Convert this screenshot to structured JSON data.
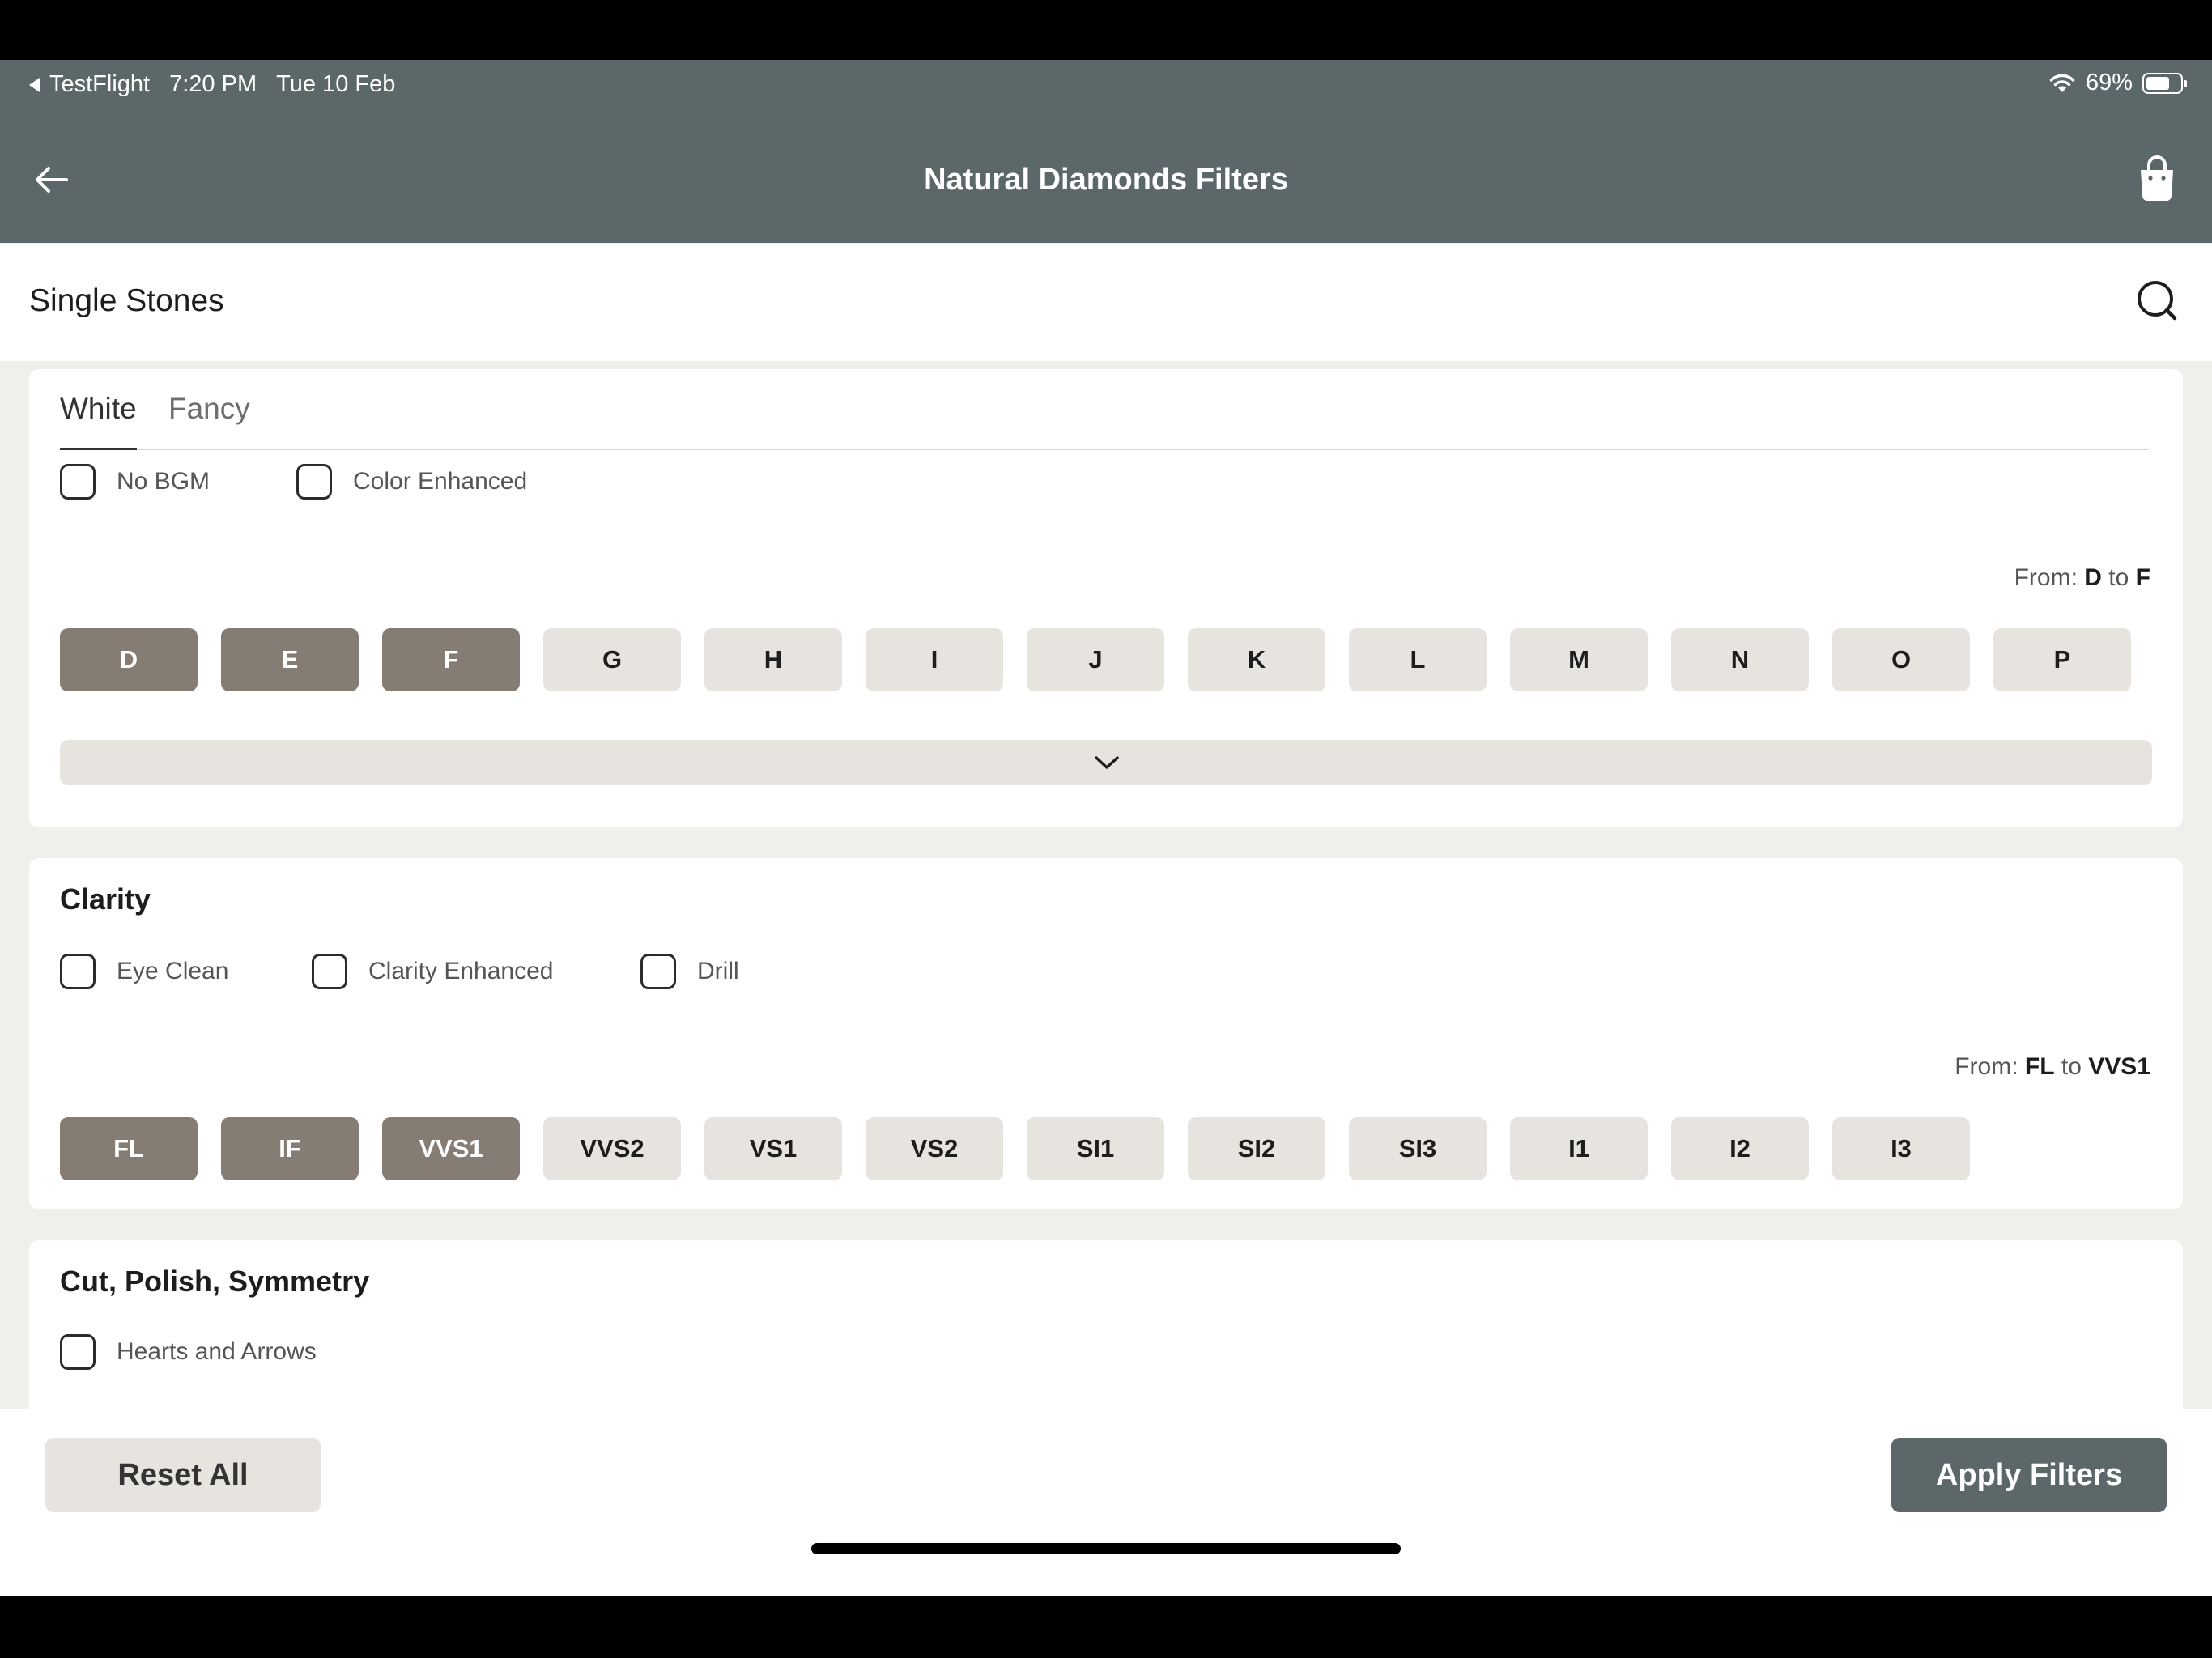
{
  "status_bar": {
    "back_app": "TestFlight",
    "time": "7:20 PM",
    "date": "Tue 10 Feb",
    "battery": "69%",
    "battery_level": 0.69
  },
  "header": {
    "title": "Natural Diamonds Filters",
    "back_icon": "arrow-left-icon",
    "cart_icon": "shopping-bag-icon"
  },
  "subheader": {
    "title": "Single Stones",
    "search_icon": "search-icon"
  },
  "color_section": {
    "tabs": [
      {
        "label": "White",
        "active": true
      },
      {
        "label": "Fancy",
        "active": false
      }
    ],
    "checkboxes": [
      {
        "label": "No BGM",
        "checked": false
      },
      {
        "label": "Color Enhanced",
        "checked": false
      }
    ],
    "range": {
      "prefix": "From:",
      "from": "D",
      "mid": "to",
      "to": "F"
    },
    "grades": [
      {
        "label": "D",
        "selected": true
      },
      {
        "label": "E",
        "selected": true
      },
      {
        "label": "F",
        "selected": true
      },
      {
        "label": "G",
        "selected": false
      },
      {
        "label": "H",
        "selected": false
      },
      {
        "label": "I",
        "selected": false
      },
      {
        "label": "J",
        "selected": false
      },
      {
        "label": "K",
        "selected": false
      },
      {
        "label": "L",
        "selected": false
      },
      {
        "label": "M",
        "selected": false
      },
      {
        "label": "N",
        "selected": false
      },
      {
        "label": "O",
        "selected": false
      },
      {
        "label": "P",
        "selected": false
      }
    ],
    "expand_icon": "chevron-down-icon"
  },
  "clarity_section": {
    "title": "Clarity",
    "checkboxes": [
      {
        "label": "Eye Clean",
        "checked": false
      },
      {
        "label": "Clarity Enhanced",
        "checked": false
      },
      {
        "label": "Drill",
        "checked": false
      }
    ],
    "range": {
      "prefix": "From:",
      "from": "FL",
      "mid": "to",
      "to": "VVS1"
    },
    "grades": [
      {
        "label": "FL",
        "selected": true
      },
      {
        "label": "IF",
        "selected": true
      },
      {
        "label": "VVS1",
        "selected": true
      },
      {
        "label": "VVS2",
        "selected": false
      },
      {
        "label": "VS1",
        "selected": false
      },
      {
        "label": "VS2",
        "selected": false
      },
      {
        "label": "SI1",
        "selected": false
      },
      {
        "label": "SI2",
        "selected": false
      },
      {
        "label": "SI3",
        "selected": false
      },
      {
        "label": "I1",
        "selected": false
      },
      {
        "label": "I2",
        "selected": false
      },
      {
        "label": "I3",
        "selected": false
      }
    ]
  },
  "cut_section": {
    "title": "Cut, Polish, Symmetry",
    "checkboxes": [
      {
        "label": "Hearts and Arrows",
        "checked": false
      }
    ]
  },
  "footer": {
    "reset_label": "Reset All",
    "apply_label": "Apply Filters"
  },
  "colors": {
    "header_bg": "#5c6769",
    "selected_chip": "#857d74",
    "unselected_chip": "#e7e4df",
    "page_bg": "#f1efeb"
  }
}
